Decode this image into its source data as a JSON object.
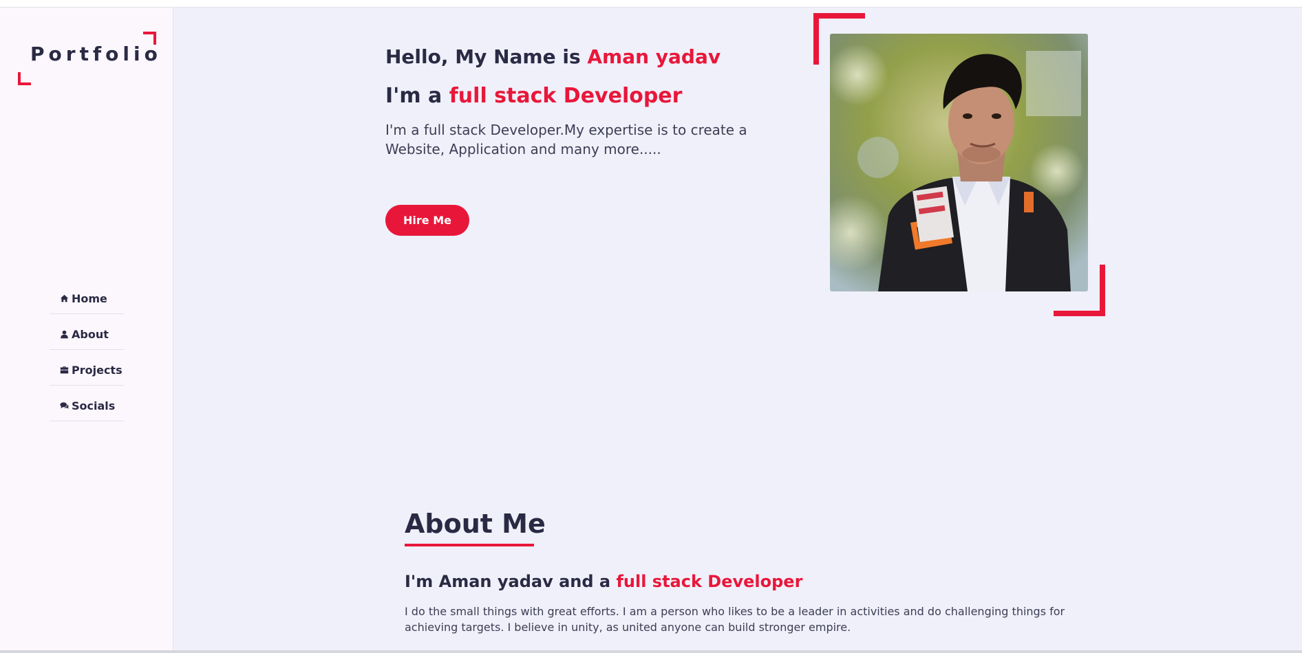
{
  "sidebar": {
    "logo": "Portfolio",
    "nav": [
      {
        "label": "Home",
        "icon": "home-icon"
      },
      {
        "label": "About",
        "icon": "user-icon"
      },
      {
        "label": "Projects",
        "icon": "briefcase-icon"
      },
      {
        "label": "Socials",
        "icon": "comments-icon"
      }
    ]
  },
  "hero": {
    "greeting_prefix": "Hello, My Name is ",
    "name": "Aman yadav",
    "role_prefix": "I'm a ",
    "role": "full stack Developer",
    "description": "I'm a full stack Developer.My expertise is to create a Website, Application and many more.....",
    "hire_button": "Hire Me",
    "photo_alt": "profile photo"
  },
  "about": {
    "title": "About Me",
    "sub_prefix": "I'm Aman yadav and a ",
    "sub_accent": "full stack Developer",
    "text": "I do the small things with great efforts. I am a person who likes to be a leader in activities and do challenging things for achieving targets. I believe in unity, as united anyone can build stronger empire."
  },
  "colors": {
    "accent": "#e8173a",
    "text_dark": "#2a2a44",
    "background": "#f0f0fa",
    "sidebar": "#fbf7fd"
  }
}
